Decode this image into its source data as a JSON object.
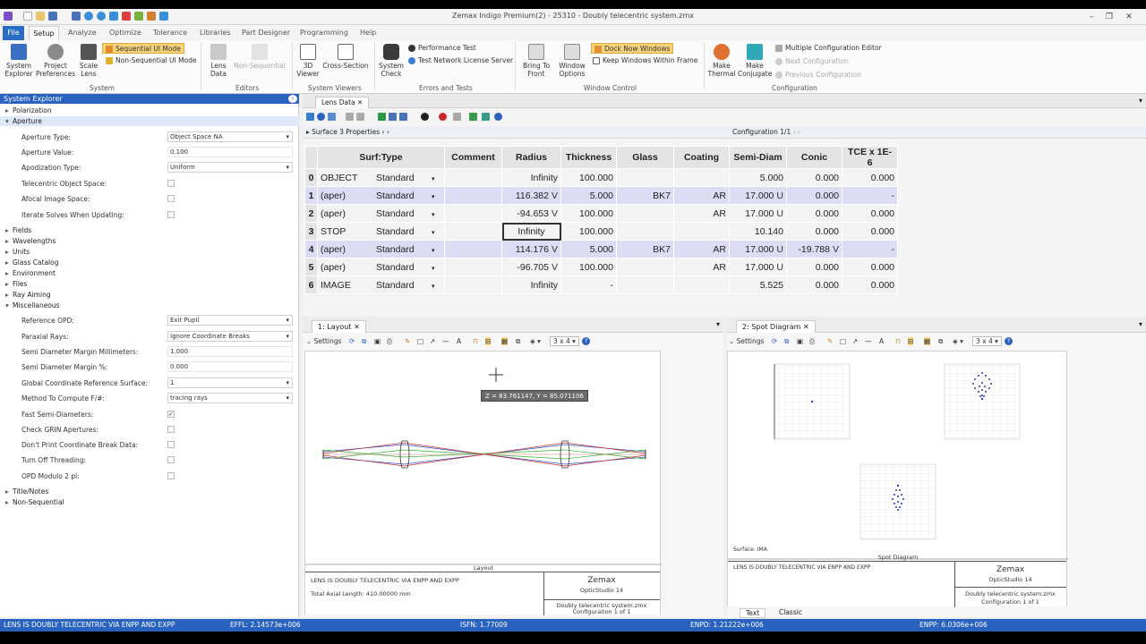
{
  "window": {
    "title": "Zemax Indigo Premium(2) - 25310 - Doubly telecentric system.zmx"
  },
  "menu": {
    "file": "File",
    "tabs": [
      "Setup",
      "Analyze",
      "Optimize",
      "Tolerance",
      "Libraries",
      "Part Designer",
      "Programming",
      "Help"
    ]
  },
  "ribbon": {
    "system_explorer": "System Explorer",
    "project_preferences": "Project Preferences",
    "scale_lens": "Scale Lens",
    "sequential": "Sequential UI Mode",
    "non_sequential": "Non-Sequential UI Mode",
    "lens_data": "Lens Data",
    "non_sequential_btn": "Non-Sequential",
    "viewer_3d": "3D Viewer",
    "cross_section": "Cross-Section",
    "system_check": "System Check",
    "performance_test": "Performance Test",
    "test_network": "Test Network License Server",
    "bring_to_front": "Bring To Front",
    "window_options": "Window Options",
    "dock_now": "Dock Now Windows",
    "keep_within": "Keep Windows Within Frame",
    "make_thermal": "Make Thermal",
    "make_conjugate": "Make Conjugate",
    "mce": "Multiple Configuration Editor",
    "next_config": "Next Configuration",
    "prev_config": "Previous Configuration",
    "groups": {
      "system": "System",
      "editors": "Editors",
      "viewers": "System Viewers",
      "errors": "Errors and Tests",
      "window": "Window Control",
      "configuration": "Configuration"
    }
  },
  "sidebar": {
    "title": "System Explorer",
    "polarization": "Polarization",
    "aperture": "Aperture",
    "aperture_props": [
      {
        "label": "Aperture Type:",
        "value": "Object Space NA"
      },
      {
        "label": "Aperture Value:",
        "value": "0.100"
      },
      {
        "label": "Apodization Type:",
        "value": "Uniform"
      },
      {
        "label": "Telecentric Object Space:",
        "value": ""
      },
      {
        "label": "Afocal Image Space:",
        "value": ""
      },
      {
        "label": "Iterate Solves When Updating:",
        "value": ""
      }
    ],
    "sections": [
      "Fields",
      "Wavelengths",
      "Units",
      "Glass Catalog",
      "Environment",
      "Files",
      "Ray Aiming",
      "Miscellaneous"
    ],
    "misc_props": [
      {
        "label": "Reference OPD:",
        "value": "Exit Pupil"
      },
      {
        "label": "Paraxial Rays:",
        "value": "Ignore Coordinate Breaks"
      },
      {
        "label": "Semi Diameter Margin Millimeters:",
        "value": "1.000"
      },
      {
        "label": "Semi Diameter Margin %:",
        "value": "0.000"
      },
      {
        "label": "Global Coordinate Reference Surface:",
        "value": "1"
      },
      {
        "label": "Method To Compute F/#:",
        "value": "tracing rays"
      },
      {
        "label": "Fast Semi-Diameters:",
        "value": "✓"
      },
      {
        "label": "Check GRIN Apertures:",
        "value": ""
      },
      {
        "label": "Don't Print Coordinate Break Data:",
        "value": ""
      },
      {
        "label": "Turn Off Threading:",
        "value": ""
      },
      {
        "label": "OPD Modulo 2 pi:",
        "value": ""
      }
    ],
    "title_notes": "Title/Notes",
    "non_sequential": "Non-Sequential"
  },
  "lens_data": {
    "tab": "Lens Data",
    "surface_props": "Surface 3 Properties",
    "configuration": "Configuration 1/1",
    "columns": [
      "",
      "Surf:Type",
      "Comment",
      "Radius",
      "Thickness",
      "Glass",
      "Coating",
      "Semi-Diam",
      "Conic",
      "TCE x 1E-6"
    ],
    "rows": [
      {
        "n": "0",
        "name": "OBJECT",
        "type": "Standard",
        "radius": "Infinity",
        "rs": "",
        "thickness": "100.000",
        "glass": "",
        "coating": "",
        "semi": "5.000",
        "ss": "",
        "conic": "0.000",
        "cs": "",
        "tce": "0.000"
      },
      {
        "n": "1",
        "name": "(aper)",
        "type": "Standard",
        "radius": "116.382",
        "rs": "V",
        "thickness": "5.000",
        "glass": "BK7",
        "coating": "AR",
        "semi": "17.000",
        "ss": "U",
        "conic": "0.000",
        "cs": "",
        "tce": "-"
      },
      {
        "n": "2",
        "name": "(aper)",
        "type": "Standard",
        "radius": "-94.653",
        "rs": "V",
        "thickness": "100.000",
        "glass": "",
        "coating": "AR",
        "semi": "17.000",
        "ss": "U",
        "conic": "0.000",
        "cs": "",
        "tce": "0.000"
      },
      {
        "n": "3",
        "name": "STOP",
        "type": "Standard",
        "radius": "Infinity",
        "rs": "",
        "thickness": "100.000",
        "glass": "",
        "coating": "",
        "semi": "10.140",
        "ss": "",
        "conic": "0.000",
        "cs": "",
        "tce": "0.000"
      },
      {
        "n": "4",
        "name": "(aper)",
        "type": "Standard",
        "radius": "114.176",
        "rs": "V",
        "thickness": "5.000",
        "glass": "BK7",
        "coating": "AR",
        "semi": "17.000",
        "ss": "U",
        "conic": "-19.788",
        "cs": "V",
        "tce": "-"
      },
      {
        "n": "5",
        "name": "(aper)",
        "type": "Standard",
        "radius": "-96.705",
        "rs": "V",
        "thickness": "100.000",
        "glass": "",
        "coating": "AR",
        "semi": "17.000",
        "ss": "U",
        "conic": "0.000",
        "cs": "",
        "tce": "0.000"
      },
      {
        "n": "6",
        "name": "IMAGE",
        "type": "Standard",
        "radius": "Infinity",
        "rs": "",
        "thickness": "-",
        "glass": "",
        "coating": "",
        "semi": "5.525",
        "ss": "",
        "conic": "0.000",
        "cs": "",
        "tce": "0.000"
      }
    ]
  },
  "layout": {
    "tab": "1: Layout",
    "settings": "Settings",
    "grid": "3 x 4",
    "coord_tooltip": "Z = 83.761147, Y = 85.071106",
    "caption": "Layout",
    "desc": "LENS IS DOUBLY TELECENTRIC VIA ENPP AND EXPP",
    "axial": "Total Axial Length:  410.00000 mm",
    "brand": "Zemax",
    "product": "OpticStudio 14",
    "file": "Doubly telecentric system.zmx",
    "config": "Configuration 1 of 1"
  },
  "spot": {
    "tab": "2: Spot Diagram",
    "settings": "Settings",
    "grid": "3 x 4",
    "caption": "Spot Diagram",
    "desc": "LENS IS DOUBLY TELECENTRIC VIA ENPP AND EXPP",
    "brand": "Zemax",
    "product": "OpticStudio 14",
    "file": "Doubly telecentric system.zmx",
    "config": "Configuration 1 of 1",
    "subtabs": [
      "Text",
      "Classic"
    ],
    "surface": "Surface: IMA"
  },
  "status": {
    "desc": "LENS IS DOUBLY TELECENTRIC VIA ENPP AND EXPP",
    "effl": "EFFL: 2.14573e+006",
    "isfn": "ISFN: 1.77009",
    "enpd": "ENPD: 1.21222e+006",
    "enpp": "ENPP: 6.0306e+006"
  }
}
